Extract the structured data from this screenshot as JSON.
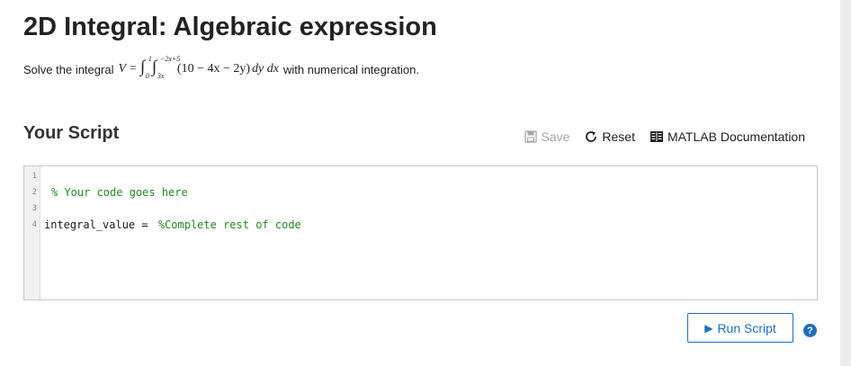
{
  "page": {
    "title": "2D Integral: Algebraic expression"
  },
  "problem": {
    "prefix": "Solve the integral",
    "lhs": "V",
    "equals": "=",
    "outer_upper": "1",
    "outer_lower": "0",
    "inner_upper": "−2x+5",
    "inner_lower": "3x",
    "integrand": "(10 − 4x − 2y)",
    "differentials": "dy dx",
    "suffix": "with numerical integration."
  },
  "script": {
    "heading": "Your Script",
    "toolbar": {
      "save_label": "Save",
      "reset_label": "Reset",
      "docs_label": "MATLAB Documentation"
    },
    "lines": [
      {
        "num": "1",
        "code": "",
        "comment": ""
      },
      {
        "num": "2",
        "code": "",
        "comment": "% Your code goes here"
      },
      {
        "num": "3",
        "code": "",
        "comment": ""
      },
      {
        "num": "4",
        "code": "integral_value = ",
        "comment": "%Complete rest of code"
      }
    ],
    "run_label": "Run Script",
    "help_glyph": "?"
  },
  "colors": {
    "accent": "#1f6fbf",
    "comment": "#228822",
    "disabled": "#a6a6a6"
  },
  "icons": {
    "save": "floppy-disk-icon",
    "reset": "circular-arrow-icon",
    "docs": "book-icon",
    "run": "play-icon",
    "help": "question-circle-icon"
  }
}
